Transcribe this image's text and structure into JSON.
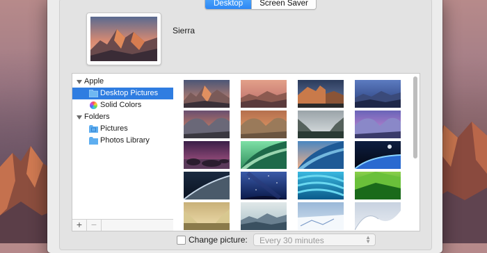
{
  "tabs": [
    {
      "label": "Desktop",
      "active": true
    },
    {
      "label": "Screen Saver",
      "active": false
    }
  ],
  "preview": {
    "name": "Sierra"
  },
  "sources": [
    {
      "kind": "group",
      "label": "Apple",
      "icon": "disclosure-triangle-icon"
    },
    {
      "kind": "item",
      "label": "Desktop Pictures",
      "icon": "folder-icon",
      "selected": true
    },
    {
      "kind": "item",
      "label": "Solid Colors",
      "icon": "color-wheel-icon"
    },
    {
      "kind": "group",
      "label": "Folders",
      "icon": "disclosure-triangle-icon"
    },
    {
      "kind": "item",
      "label": "Pictures",
      "icon": "pictures-folder-icon"
    },
    {
      "kind": "item",
      "label": "Photos Library",
      "icon": "folder-icon"
    }
  ],
  "list_buttons": {
    "add": "+",
    "remove": "−"
  },
  "wallpapers": [
    {
      "name": "sierra-mountains",
      "sky": "#d88a6e",
      "sky2": "#4c5676",
      "land": "#3a3038",
      "land2": "#7a5a58",
      "kind": "peaks"
    },
    {
      "name": "sierra-sunset",
      "sky": "#b96a68",
      "sky2": "#e3a089",
      "land": "#5a3a3c",
      "land2": "#8c5a50",
      "kind": "ridge"
    },
    {
      "name": "el-capitan",
      "sky": "#6b7fa6",
      "sky2": "#2b3b5c",
      "land": "#8a5436",
      "land2": "#c97a4a",
      "kind": "cliff"
    },
    {
      "name": "el-capitan-night",
      "sky": "#283d7a",
      "sky2": "#5c7bc0",
      "land": "#1e2748",
      "land2": "#3a4a7a",
      "kind": "ridge"
    },
    {
      "name": "yosemite-dusk",
      "sky": "#e48e5e",
      "sky2": "#6a4f70",
      "land": "#3a3840",
      "land2": "#6a6878",
      "kind": "dome"
    },
    {
      "name": "yosemite-cliffs",
      "sky": "#e9a06a",
      "sky2": "#b5704e",
      "land": "#6b5540",
      "land2": "#9a7a5a",
      "kind": "dome"
    },
    {
      "name": "yosemite-valley",
      "sky": "#dfe4e6",
      "sky2": "#9aa3a8",
      "land": "#2a3a34",
      "land2": "#55615c",
      "kind": "valley"
    },
    {
      "name": "yosemite-purple",
      "sky": "#d48ed6",
      "sky2": "#6a64b8",
      "land": "#3a3a6a",
      "land2": "#8a88c8",
      "kind": "dome"
    },
    {
      "name": "beach-rocks",
      "sky": "#b45a8a",
      "sky2": "#3a1f48",
      "land": "#2a1d2e",
      "land2": "#5a3a5a",
      "kind": "rocks"
    },
    {
      "name": "green-wave",
      "sky": "#2f8d5c",
      "sky2": "#7ee0a6",
      "land": "#1e6a4a",
      "land2": "#b8f0c8",
      "kind": "wave"
    },
    {
      "name": "blue-wave",
      "sky": "#f0b08a",
      "sky2": "#4a86c0",
      "land": "#1e5a96",
      "land2": "#8ad0f0",
      "kind": "wave"
    },
    {
      "name": "earth-horizon",
      "sky": "#040814",
      "sky2": "#0e1e40",
      "land": "#2a6ad0",
      "land2": "#8ad4ff",
      "kind": "planet"
    },
    {
      "name": "earth-orbit",
      "sky": "#0a1220",
      "sky2": "#1a2a40",
      "land": "#4a5a6a",
      "land2": "#c8d8e8",
      "kind": "orbit"
    },
    {
      "name": "milky-way",
      "sky": "#0a1a4a",
      "sky2": "#3a5aa8",
      "land": "#0a1030",
      "land2": "#2a3a7a",
      "kind": "stars"
    },
    {
      "name": "aqua-lines",
      "sky": "#0a5a8a",
      "sky2": "#3ab8e0",
      "land": "#0a4a7a",
      "land2": "#6ad8f0",
      "kind": "lines"
    },
    {
      "name": "green-fields",
      "sky": "#2a8a2a",
      "sky2": "#8ad04a",
      "land": "#1a6a1a",
      "land2": "#6ac03a",
      "kind": "fields"
    },
    {
      "name": "golden-grass",
      "sky": "#f0e0b0",
      "sky2": "#c8b078",
      "land": "#8a7a4a",
      "land2": "#d8c890",
      "kind": "valley"
    },
    {
      "name": "misty-hills",
      "sky": "#a8c0c8",
      "sky2": "#e0e8e8",
      "land": "#3a5060",
      "land2": "#6a8090",
      "kind": "ridge"
    },
    {
      "name": "snow-ice",
      "sky": "#d8e4f0",
      "sky2": "#9ab8d8",
      "land": "#f4f8fc",
      "land2": "#7a9ac8",
      "kind": "ice"
    },
    {
      "name": "snow-dunes",
      "sky": "#e8ecf2",
      "sky2": "#c8d2e0",
      "land": "#ffffff",
      "land2": "#b8c4d4",
      "kind": "dunes"
    }
  ],
  "bottom": {
    "change_label": "Change picture:",
    "interval_value": "Every 30 minutes"
  }
}
